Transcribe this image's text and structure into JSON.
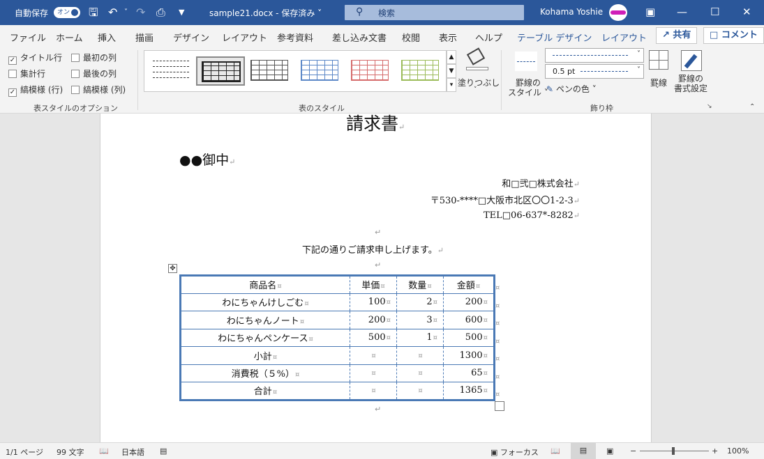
{
  "titlebar": {
    "autosave_label": "自動保存",
    "autosave_toggle": "オン",
    "doc_title": "sample21.docx - 保存済み ˅",
    "search_placeholder": "検索",
    "user_name": "Kohama Yoshie",
    "bg_color": "#2b579a"
  },
  "tabs": [
    "ファイル",
    "ホーム",
    "挿入",
    "描画",
    "デザイン",
    "レイアウト",
    "参考資料",
    "差し込み文書",
    "校閲",
    "表示",
    "ヘルプ",
    "テーブル デザイン",
    "レイアウト"
  ],
  "active_tab": "テーブル デザイン",
  "share_button": "共有",
  "comment_button": "コメント",
  "ribbon": {
    "style_options": {
      "items": [
        {
          "label": "タイトル行",
          "checked": true
        },
        {
          "label": "最初の列",
          "checked": false
        },
        {
          "label": "集計行",
          "checked": false
        },
        {
          "label": "最後の列",
          "checked": false
        },
        {
          "label": "縞模様 (行)",
          "checked": true
        },
        {
          "label": "縞模様 (列)",
          "checked": false
        }
      ],
      "group_label": "表スタイルのオプション"
    },
    "table_styles": {
      "group_label": "表のスタイル",
      "shading_label": "塗りつぶし"
    },
    "borders": {
      "border_style_label": "罫線の\nスタイル ˅",
      "weight": "0.5 pt",
      "pen_color_label": "ペンの色 ˅",
      "borders_label": "罫線",
      "painter_label": "罫線の\n書式設定",
      "group_label": "飾り枠"
    }
  },
  "document": {
    "title": "請求書",
    "addressee": "●●御中",
    "company": "和□弐□株式会社",
    "address": "〒530-****□大阪市北区〇〇1-2-3",
    "tel": "TEL□06-637*-8282",
    "intro": "下記の通りご請求申し上げます。",
    "table": {
      "headers": [
        "商品名",
        "単価",
        "数量",
        "金額"
      ],
      "rows": [
        [
          "わにちゃんけしごむ",
          "100",
          "2",
          "200"
        ],
        [
          "わにちゃんノート",
          "200",
          "3",
          "600"
        ],
        [
          "わにちゃんペンケース",
          "500",
          "1",
          "500"
        ],
        [
          "小計",
          "",
          "",
          "1300"
        ],
        [
          "消費税（５%）",
          "",
          "",
          "65"
        ],
        [
          "合計",
          "",
          "",
          "1365"
        ]
      ]
    }
  },
  "statusbar": {
    "page": "1/1 ページ",
    "words": "99 文字",
    "language": "日本語",
    "focus": "フォーカス",
    "zoom": "100%"
  }
}
